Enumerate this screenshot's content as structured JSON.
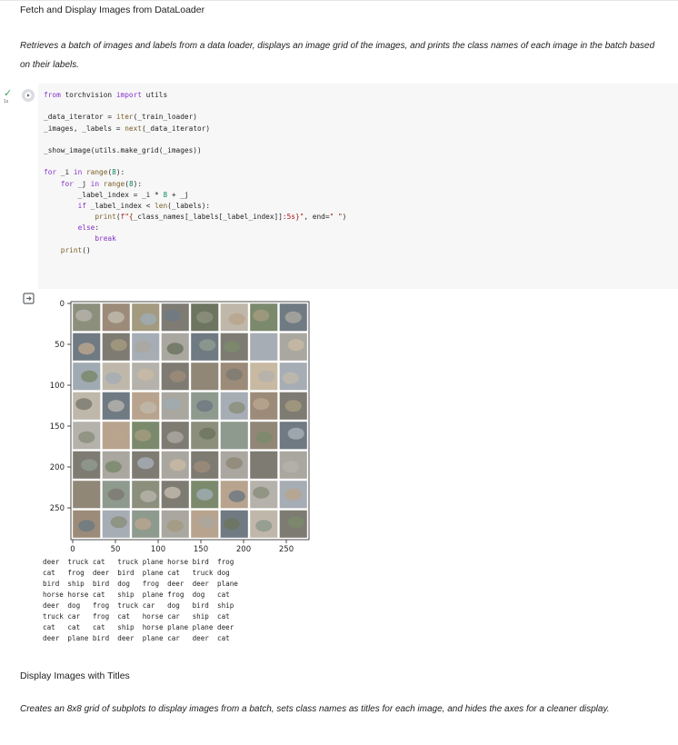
{
  "section1": {
    "title": "Fetch and Display Images from DataLoader",
    "description": "Retrieves a batch of images and labels from a data loader, displays an image grid of the images, and prints the class names of each image in the batch based on their labels."
  },
  "cell": {
    "status_icon": "check-icon",
    "exec_time": "1s",
    "run_icon": "play-icon",
    "code": [
      "from torchvision import utils",
      "",
      "_data_iterator = iter(_train_loader)",
      "_images, _labels = next(_data_iterator)",
      "",
      "_show_image(utils.make_grid(_images))",
      "",
      "for _i in range(8):",
      "    for _j in range(8):",
      "        _label_index = _i * 8 + _j",
      "        if _label_index < len(_labels):",
      "            print(f\"{_class_names[_labels[_label_index]]:5s}\", end=\" \")",
      "        else:",
      "            break",
      "    print()"
    ]
  },
  "output": {
    "icon": "output-toggle-icon",
    "colors": {
      "tile_palette": [
        "#8c8f7c",
        "#a9a7a0",
        "#7b8a6c",
        "#9c8b78",
        "#b5b2ac",
        "#6f7a83",
        "#a39a7f",
        "#8f9a8f",
        "#c8b9a2",
        "#7e7b73",
        "#9faab2",
        "#b8a48e",
        "#6d7560",
        "#a6adb5",
        "#918777",
        "#bfb8aa"
      ]
    },
    "plot": {
      "y_ticks": [
        "0",
        "50",
        "100",
        "150",
        "200",
        "250"
      ],
      "x_ticks": [
        "0",
        "50",
        "100",
        "150",
        "200",
        "250"
      ]
    },
    "printed_labels": [
      "deer  truck cat   truck plane horse bird  frog",
      "cat   frog  deer  bird  plane cat   truck dog",
      "bird  ship  bird  dog   frog  deer  deer  plane",
      "horse horse cat   ship  plane frog  dog   cat",
      "deer  dog   frog  truck car   dog   bird  ship",
      "truck car   frog  cat   horse car   ship  cat",
      "cat   cat   cat   ship  horse plane plane deer",
      "deer  plane bird  deer  plane car   deer  cat"
    ],
    "grid_labels": [
      [
        "deer",
        "truck",
        "cat",
        "truck",
        "plane",
        "horse",
        "bird",
        "frog"
      ],
      [
        "cat",
        "frog",
        "deer",
        "bird",
        "plane",
        "cat",
        "truck",
        "dog"
      ],
      [
        "bird",
        "ship",
        "bird",
        "dog",
        "frog",
        "deer",
        "deer",
        "plane"
      ],
      [
        "horse",
        "horse",
        "cat",
        "ship",
        "plane",
        "frog",
        "dog",
        "cat"
      ],
      [
        "deer",
        "dog",
        "frog",
        "truck",
        "car",
        "dog",
        "bird",
        "ship"
      ],
      [
        "truck",
        "car",
        "frog",
        "cat",
        "horse",
        "car",
        "ship",
        "cat"
      ],
      [
        "cat",
        "cat",
        "cat",
        "ship",
        "horse",
        "plane",
        "plane",
        "deer"
      ],
      [
        "deer",
        "plane",
        "bird",
        "deer",
        "plane",
        "car",
        "deer",
        "cat"
      ]
    ]
  },
  "section2": {
    "title": "Display Images with Titles",
    "description": "Creates an 8x8 grid of subplots to display images from a batch, sets class names as titles for each image, and hides the axes for a cleaner display."
  }
}
